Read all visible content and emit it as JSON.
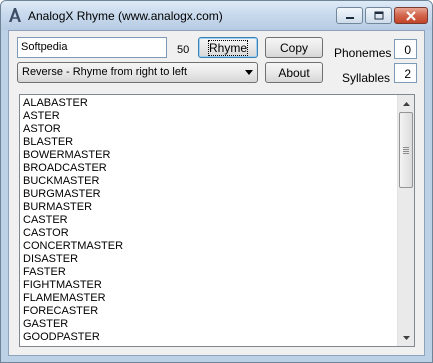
{
  "window": {
    "title": "AnalogX Rhyme (www.analogx.com)"
  },
  "search": {
    "value": "Softpedia",
    "count": "50"
  },
  "buttons": {
    "rhyme": "Rhyme",
    "copy": "Copy",
    "about": "About"
  },
  "mode": {
    "selected": "Reverse - Rhyme from right to left"
  },
  "stats": {
    "phonemes_label": "Phonemes",
    "phonemes_value": "0",
    "syllables_label": "Syllables",
    "syllables_value": "2"
  },
  "results": [
    "ALABASTER",
    "ASTER",
    "ASTOR",
    "BLASTER",
    "BOWERMASTER",
    "BROADCASTER",
    "BUCKMASTER",
    "BURGMASTER",
    "BURMASTER",
    "CASTER",
    "CASTOR",
    "CONCERTMASTER",
    "DISASTER",
    "FASTER",
    "FIGHTMASTER",
    "FLAMEMASTER",
    "FORECASTER",
    "GASTER",
    "GOODPASTER"
  ],
  "colors": {
    "titlebar": "#c9daed",
    "client": "#f0f0f0",
    "close_button": "#c2442a",
    "default_button_border": "#3c7fb1"
  },
  "icons": {
    "app": "analogx-app-icon",
    "minimize": "minimize-icon",
    "maximize": "maximize-icon",
    "close": "close-icon",
    "dropdown": "chevron-down-icon",
    "scroll_up": "scroll-up-arrow-icon",
    "scroll_down": "scroll-down-arrow-icon"
  }
}
